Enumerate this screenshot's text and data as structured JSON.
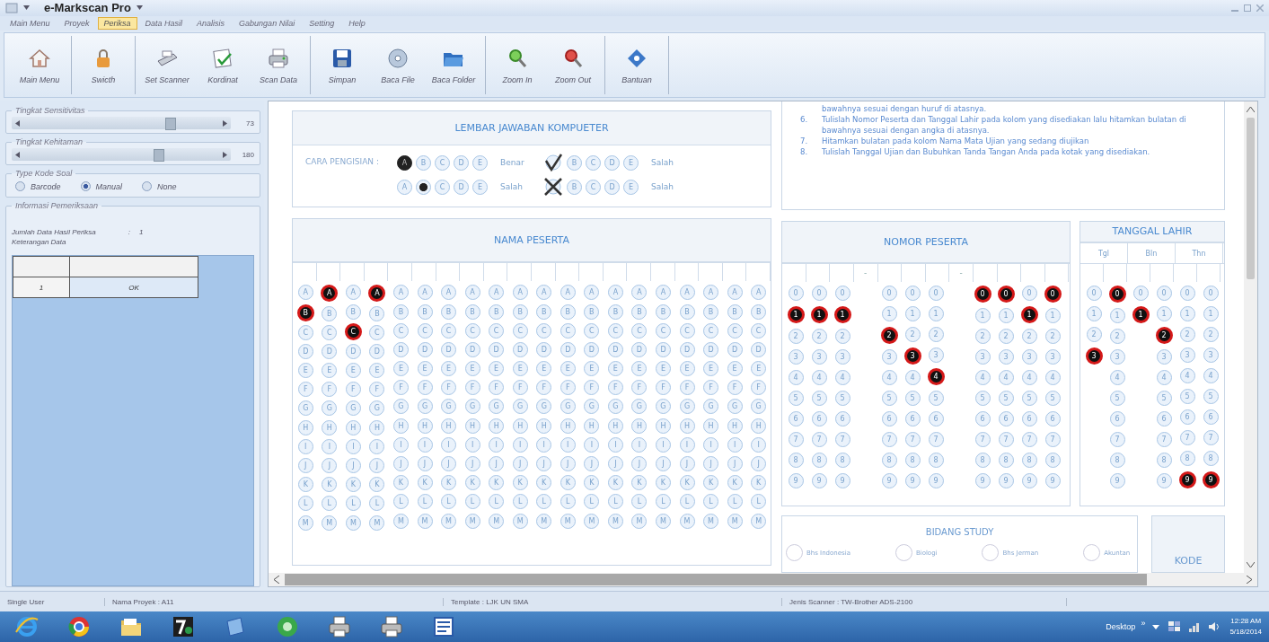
{
  "window": {
    "title": "e-Markscan Pro"
  },
  "menu": [
    {
      "label": "Main Menu",
      "selected": false
    },
    {
      "label": "Proyek",
      "selected": false
    },
    {
      "label": "Periksa",
      "selected": true
    },
    {
      "label": "Data Hasil",
      "selected": false
    },
    {
      "label": "Analisis",
      "selected": false
    },
    {
      "label": "Gabungan Nilai",
      "selected": false
    },
    {
      "label": "Setting",
      "selected": false
    },
    {
      "label": "Help",
      "selected": false
    }
  ],
  "toolbar": {
    "groups": [
      [
        {
          "label": "Main Menu",
          "kind": "home"
        }
      ],
      [
        {
          "label": "Swicth",
          "kind": "lock"
        }
      ],
      [
        {
          "label": "Set Scanner",
          "kind": "scanner"
        },
        {
          "label": "Kordinat",
          "kind": "document"
        },
        {
          "label": "Scan Data",
          "kind": "printer"
        }
      ],
      [
        {
          "label": "Simpan",
          "kind": "floppy"
        },
        {
          "label": "Baca File",
          "kind": "disc"
        },
        {
          "label": "Baca Folder",
          "kind": "folder"
        }
      ],
      [
        {
          "label": "Zoom In",
          "kind": "zoom_in"
        },
        {
          "label": "Zoom Out",
          "kind": "zoom_out"
        }
      ],
      [
        {
          "label": "Bantuan",
          "kind": "help"
        }
      ]
    ]
  },
  "settings": {
    "sliders": [
      {
        "label": "Tingkat Sensitivitas",
        "level": 0.72,
        "value": "73"
      },
      {
        "label": "Tingkat Kehitaman",
        "level": 0.67,
        "value": "180"
      }
    ],
    "code_type": {
      "label": "Type Kode Soal",
      "options": [
        {
          "label": "Barcode",
          "selected": false
        },
        {
          "label": "Manual",
          "selected": true
        },
        {
          "label": "None",
          "selected": false
        }
      ]
    },
    "info": {
      "label": "Informasi Pemeriksaan",
      "count_label": "Jumlah Data Hasil Periksa",
      "separator": ":",
      "count": "1",
      "notes_label": "Keterangan Data",
      "rows": [
        [
          "1",
          "OK"
        ]
      ]
    }
  },
  "sheet": {
    "title": "LEMBAR JAWABAN KOMPUETER",
    "method_label": "CARA PENGISIAN :",
    "examples": [
      {
        "groups": [
          {
            "bubbles": [
              {
                "kind": "filled",
                "text": "A"
              },
              {
                "kind": "empty",
                "text": "B"
              },
              {
                "kind": "empty",
                "text": "C"
              },
              {
                "kind": "empty",
                "text": "D"
              },
              {
                "kind": "empty",
                "text": "E"
              }
            ],
            "label": "Benar"
          },
          {
            "bubbles": [
              {
                "kind": "check"
              },
              {
                "kind": "empty",
                "text": "B"
              },
              {
                "kind": "empty",
                "text": "C"
              },
              {
                "kind": "empty",
                "text": "D"
              },
              {
                "kind": "empty",
                "text": "E"
              }
            ],
            "label": "Salah"
          }
        ]
      },
      {
        "groups": [
          {
            "bubbles": [
              {
                "kind": "empty",
                "text": "A"
              },
              {
                "kind": "dot"
              },
              {
                "kind": "empty",
                "text": "C"
              },
              {
                "kind": "empty",
                "text": "D"
              },
              {
                "kind": "empty",
                "text": "E"
              }
            ],
            "label": "Salah"
          },
          {
            "bubbles": [
              {
                "kind": "cross"
              },
              {
                "kind": "empty",
                "text": "B"
              },
              {
                "kind": "empty",
                "text": "C"
              },
              {
                "kind": "empty",
                "text": "D"
              },
              {
                "kind": "empty",
                "text": "E"
              }
            ],
            "label": "Salah"
          }
        ]
      }
    ],
    "instructions": [
      {
        "text": "bawahnya sesuai dengan huruf di atasnya."
      },
      {
        "number": "6.",
        "text": "Tulislah Nomor Peserta dan Tanggal Lahir pada kolom yang disediakan lalu hitamkan bulatan di bawahnya sesuai dengan angka di atasnya."
      },
      {
        "number": "7.",
        "text": "Hitamkan bulatan pada kolom Nama Mata Ujian yang sedang diujikan"
      },
      {
        "number": "8.",
        "text": "Tulislah Tanggal Ujian dan Bubuhkan Tanda Tangan Anda pada kotak yang disediakan."
      }
    ],
    "nama": {
      "title": "NAMA PESERTA",
      "columns": [
        {
          "bubbles": [
            "A",
            "B",
            "C",
            "D",
            "E",
            "F",
            "G",
            "H",
            "I",
            "J",
            "K",
            "L",
            "M"
          ],
          "filled": [
            false,
            true,
            false,
            false,
            false,
            false,
            false,
            false,
            false,
            false,
            false,
            false,
            false
          ]
        },
        {
          "bubbles": [
            "A",
            "B",
            "C",
            "D",
            "E",
            "F",
            "G",
            "H",
            "I",
            "J",
            "K",
            "L",
            "M"
          ],
          "filled": [
            true,
            false,
            false,
            false,
            false,
            false,
            false,
            false,
            false,
            false,
            false,
            false,
            false
          ]
        },
        {
          "bubbles": [
            "A",
            "B",
            "C",
            "D",
            "E",
            "F",
            "G",
            "H",
            "I",
            "J",
            "K",
            "L",
            "M"
          ],
          "filled": [
            false,
            false,
            true,
            false,
            false,
            false,
            false,
            false,
            false,
            false,
            false,
            false,
            false
          ]
        },
        {
          "bubbles": [
            "A",
            "B",
            "C",
            "D",
            "E",
            "F",
            "G",
            "H",
            "I",
            "J",
            "K",
            "L",
            "M"
          ],
          "filled": [
            true,
            false,
            false,
            false,
            false,
            false,
            false,
            false,
            false,
            false,
            false,
            false,
            false
          ]
        },
        {
          "bubbles": [
            "A",
            "B",
            "C",
            "D",
            "E",
            "F",
            "G",
            "H",
            "I",
            "J",
            "K",
            "L",
            "M"
          ],
          "filled": [
            false,
            false,
            false,
            false,
            false,
            false,
            false,
            false,
            false,
            false,
            false,
            false,
            false
          ]
        },
        {
          "bubbles": [
            "A",
            "B",
            "C",
            "D",
            "E",
            "F",
            "G",
            "H",
            "I",
            "J",
            "K",
            "L",
            "M"
          ],
          "filled": [
            false,
            false,
            false,
            false,
            false,
            false,
            false,
            false,
            false,
            false,
            false,
            false,
            false
          ]
        },
        {
          "bubbles": [
            "A",
            "B",
            "C",
            "D",
            "E",
            "F",
            "G",
            "H",
            "I",
            "J",
            "K",
            "L",
            "M"
          ],
          "filled": [
            false,
            false,
            false,
            false,
            false,
            false,
            false,
            false,
            false,
            false,
            false,
            false,
            false
          ]
        },
        {
          "bubbles": [
            "A",
            "B",
            "C",
            "D",
            "E",
            "F",
            "G",
            "H",
            "I",
            "J",
            "K",
            "L",
            "M"
          ],
          "filled": [
            false,
            false,
            false,
            false,
            false,
            false,
            false,
            false,
            false,
            false,
            false,
            false,
            false
          ]
        },
        {
          "bubbles": [
            "A",
            "B",
            "C",
            "D",
            "E",
            "F",
            "G",
            "H",
            "I",
            "J",
            "K",
            "L",
            "M"
          ],
          "filled": [
            false,
            false,
            false,
            false,
            false,
            false,
            false,
            false,
            false,
            false,
            false,
            false,
            false
          ]
        },
        {
          "bubbles": [
            "A",
            "B",
            "C",
            "D",
            "E",
            "F",
            "G",
            "H",
            "I",
            "J",
            "K",
            "L",
            "M"
          ],
          "filled": [
            false,
            false,
            false,
            false,
            false,
            false,
            false,
            false,
            false,
            false,
            false,
            false,
            false
          ]
        },
        {
          "bubbles": [
            "A",
            "B",
            "C",
            "D",
            "E",
            "F",
            "G",
            "H",
            "I",
            "J",
            "K",
            "L",
            "M"
          ],
          "filled": [
            false,
            false,
            false,
            false,
            false,
            false,
            false,
            false,
            false,
            false,
            false,
            false,
            false
          ]
        },
        {
          "bubbles": [
            "A",
            "B",
            "C",
            "D",
            "E",
            "F",
            "G",
            "H",
            "I",
            "J",
            "K",
            "L",
            "M"
          ],
          "filled": [
            false,
            false,
            false,
            false,
            false,
            false,
            false,
            false,
            false,
            false,
            false,
            false,
            false
          ]
        },
        {
          "bubbles": [
            "A",
            "B",
            "C",
            "D",
            "E",
            "F",
            "G",
            "H",
            "I",
            "J",
            "K",
            "L",
            "M"
          ],
          "filled": [
            false,
            false,
            false,
            false,
            false,
            false,
            false,
            false,
            false,
            false,
            false,
            false,
            false
          ]
        },
        {
          "bubbles": [
            "A",
            "B",
            "C",
            "D",
            "E",
            "F",
            "G",
            "H",
            "I",
            "J",
            "K",
            "L",
            "M"
          ],
          "filled": [
            false,
            false,
            false,
            false,
            false,
            false,
            false,
            false,
            false,
            false,
            false,
            false,
            false
          ]
        },
        {
          "bubbles": [
            "A",
            "B",
            "C",
            "D",
            "E",
            "F",
            "G",
            "H",
            "I",
            "J",
            "K",
            "L",
            "M"
          ],
          "filled": [
            false,
            false,
            false,
            false,
            false,
            false,
            false,
            false,
            false,
            false,
            false,
            false,
            false
          ]
        },
        {
          "bubbles": [
            "A",
            "B",
            "C",
            "D",
            "E",
            "F",
            "G",
            "H",
            "I",
            "J",
            "K",
            "L",
            "M"
          ],
          "filled": [
            false,
            false,
            false,
            false,
            false,
            false,
            false,
            false,
            false,
            false,
            false,
            false,
            false
          ]
        },
        {
          "bubbles": [
            "A",
            "B",
            "C",
            "D",
            "E",
            "F",
            "G",
            "H",
            "I",
            "J",
            "K",
            "L",
            "M"
          ],
          "filled": [
            false,
            false,
            false,
            false,
            false,
            false,
            false,
            false,
            false,
            false,
            false,
            false,
            false
          ]
        },
        {
          "bubbles": [
            "A",
            "B",
            "C",
            "D",
            "E",
            "F",
            "G",
            "H",
            "I",
            "J",
            "K",
            "L",
            "M"
          ],
          "filled": [
            false,
            false,
            false,
            false,
            false,
            false,
            false,
            false,
            false,
            false,
            false,
            false,
            false
          ]
        },
        {
          "bubbles": [
            "A",
            "B",
            "C",
            "D",
            "E",
            "F",
            "G",
            "H",
            "I",
            "J",
            "K",
            "L",
            "M"
          ],
          "filled": [
            false,
            false,
            false,
            false,
            false,
            false,
            false,
            false,
            false,
            false,
            false,
            false,
            false
          ]
        },
        {
          "bubbles": [
            "A",
            "B",
            "C",
            "D",
            "E",
            "F",
            "G",
            "H",
            "I",
            "J",
            "K",
            "L",
            "M"
          ],
          "filled": [
            false,
            false,
            false,
            false,
            false,
            false,
            false,
            false,
            false,
            false,
            false,
            false,
            false
          ]
        }
      ]
    },
    "nomor": {
      "title": "NOMOR PESERTA",
      "columns": [
        {
          "kind": "digit",
          "bubbles": [
            "0",
            "1",
            "2",
            "3",
            "4",
            "5",
            "6",
            "7",
            "8",
            "9"
          ],
          "filled": [
            false,
            true,
            false,
            false,
            false,
            false,
            false,
            false,
            false,
            false
          ]
        },
        {
          "kind": "digit",
          "bubbles": [
            "0",
            "1",
            "2",
            "3",
            "4",
            "5",
            "6",
            "7",
            "8",
            "9"
          ],
          "filled": [
            false,
            true,
            false,
            false,
            false,
            false,
            false,
            false,
            false,
            false
          ]
        },
        {
          "kind": "digit",
          "bubbles": [
            "0",
            "1",
            "2",
            "3",
            "4",
            "5",
            "6",
            "7",
            "8",
            "9"
          ],
          "filled": [
            false,
            true,
            false,
            false,
            false,
            false,
            false,
            false,
            false,
            false
          ]
        },
        {
          "kind": "dash",
          "header": "-"
        },
        {
          "kind": "digit",
          "bubbles": [
            "0",
            "1",
            "2",
            "3",
            "4",
            "5",
            "6",
            "7",
            "8",
            "9"
          ],
          "filled": [
            false,
            false,
            true,
            false,
            false,
            false,
            false,
            false,
            false,
            false
          ]
        },
        {
          "kind": "digit",
          "bubbles": [
            "0",
            "1",
            "2",
            "3",
            "4",
            "5",
            "6",
            "7",
            "8",
            "9"
          ],
          "filled": [
            false,
            false,
            false,
            true,
            false,
            false,
            false,
            false,
            false,
            false
          ]
        },
        {
          "kind": "digit",
          "bubbles": [
            "0",
            "1",
            "2",
            "3",
            "4",
            "5",
            "6",
            "7",
            "8",
            "9"
          ],
          "filled": [
            false,
            false,
            false,
            false,
            true,
            false,
            false,
            false,
            false,
            false
          ]
        },
        {
          "kind": "dash",
          "header": "-"
        },
        {
          "kind": "digit",
          "bubbles": [
            "0",
            "1",
            "2",
            "3",
            "4",
            "5",
            "6",
            "7",
            "8",
            "9"
          ],
          "filled": [
            true,
            false,
            false,
            false,
            false,
            false,
            false,
            false,
            false,
            false
          ]
        },
        {
          "kind": "digit",
          "bubbles": [
            "0",
            "1",
            "2",
            "3",
            "4",
            "5",
            "6",
            "7",
            "8",
            "9"
          ],
          "filled": [
            true,
            false,
            false,
            false,
            false,
            false,
            false,
            false,
            false,
            false
          ]
        },
        {
          "kind": "digit",
          "bubbles": [
            "0",
            "1",
            "2",
            "3",
            "4",
            "5",
            "6",
            "7",
            "8",
            "9"
          ],
          "filled": [
            false,
            true,
            false,
            false,
            false,
            false,
            false,
            false,
            false,
            false
          ]
        },
        {
          "kind": "digit",
          "bubbles": [
            "0",
            "1",
            "2",
            "3",
            "4",
            "5",
            "6",
            "7",
            "8",
            "9"
          ],
          "filled": [
            true,
            false,
            false,
            false,
            false,
            false,
            false,
            false,
            false,
            false
          ]
        }
      ]
    },
    "tanggal": {
      "title": "TANGGAL LAHIR",
      "headers": [
        "Tgl",
        "Bln",
        "Thn"
      ],
      "columns": [
        {
          "bubbles": [
            "0",
            "1",
            "2",
            "3"
          ],
          "filled": [
            false,
            false,
            false,
            true
          ]
        },
        {
          "bubbles": [
            "0",
            "1",
            "2",
            "3",
            "4",
            "5",
            "6",
            "7",
            "8",
            "9"
          ],
          "filled": [
            true,
            false,
            false,
            false,
            false,
            false,
            false,
            false,
            false,
            false
          ]
        },
        {
          "bubbles": [
            "0",
            "1"
          ],
          "filled": [
            false,
            true
          ]
        },
        {
          "bubbles": [
            "0",
            "1",
            "2",
            "3",
            "4",
            "5",
            "6",
            "7",
            "8",
            "9"
          ],
          "filled": [
            false,
            false,
            true,
            false,
            false,
            false,
            false,
            false,
            false,
            false
          ]
        },
        {
          "bubbles": [
            "0",
            "1",
            "2",
            "3",
            "4",
            "5",
            "6",
            "7",
            "8",
            "9"
          ],
          "filled": [
            false,
            false,
            false,
            false,
            false,
            false,
            false,
            false,
            false,
            true
          ]
        },
        {
          "bubbles": [
            "0",
            "1",
            "2",
            "3",
            "4",
            "5",
            "6",
            "7",
            "8",
            "9"
          ],
          "filled": [
            false,
            false,
            false,
            false,
            false,
            false,
            false,
            false,
            false,
            true
          ]
        }
      ]
    },
    "bidang": {
      "title": "BIDANG STUDY",
      "options": [
        "Bhs Indonesia",
        "Biologi",
        "Bhs Jerman",
        "Akuntan"
      ]
    },
    "kode": {
      "title": "KODE"
    }
  },
  "status_bar": [
    "Single User",
    "Nama Proyek : A11",
    "Template : LJK UN SMA",
    "Jenis Scanner : TW-Brother ADS-2100"
  ],
  "taskbar": {
    "apps": [
      {
        "kind": "browser"
      },
      {
        "kind": "chrome"
      },
      {
        "kind": "folder"
      },
      {
        "kind": "archive"
      },
      {
        "kind": "window"
      },
      {
        "kind": "green"
      },
      {
        "kind": "printer"
      },
      {
        "kind": "printer"
      },
      {
        "kind": "document"
      }
    ],
    "desktop": "Desktop",
    "chevron": "»",
    "time": "12:28 AM",
    "date": "5/18/2014"
  }
}
